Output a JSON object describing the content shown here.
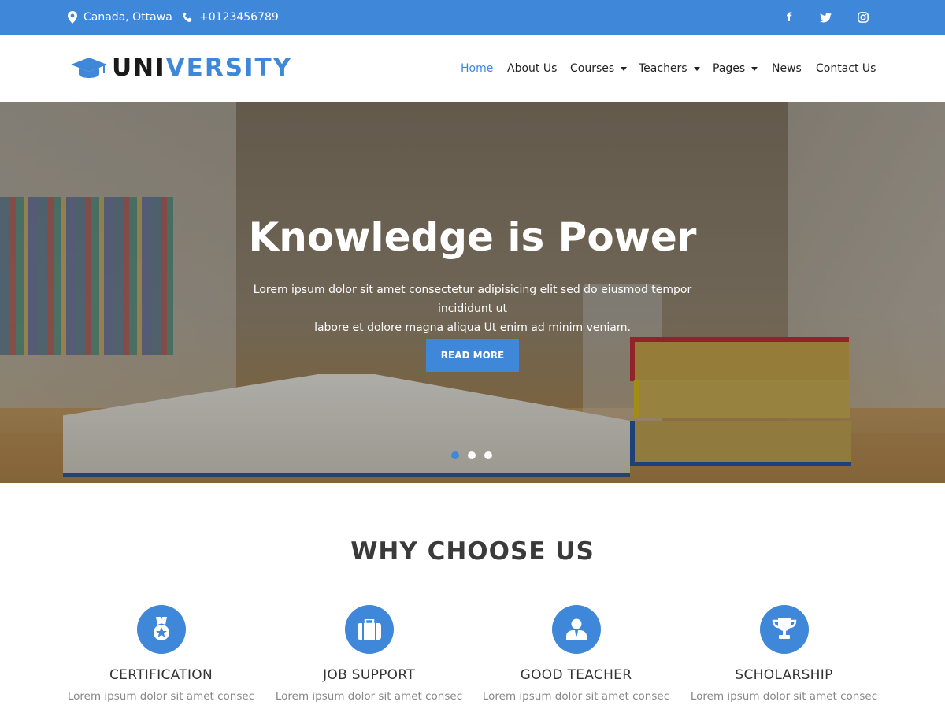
{
  "topbar": {
    "location": "Canada, Ottawa",
    "phone": "+0123456789",
    "social": [
      {
        "icon": "facebook-icon",
        "glyph": "f"
      },
      {
        "icon": "twitter-icon"
      },
      {
        "icon": "instagram-icon"
      }
    ]
  },
  "brand": {
    "part1": "UNI",
    "part2": "VERSITY",
    "accent_color": "#3f87d9"
  },
  "nav": [
    {
      "label": "Home",
      "active": true
    },
    {
      "label": "About Us"
    },
    {
      "label": "Courses",
      "dropdown": true
    },
    {
      "label": "Teachers",
      "dropdown": true
    },
    {
      "label": "Pages",
      "dropdown": true
    },
    {
      "label": "News"
    },
    {
      "label": "Contact Us"
    }
  ],
  "hero": {
    "title": "Knowledge is Power",
    "subtitle_line1": "Lorem ipsum dolor sit amet consectetur adipisicing elit sed do eiusmod tempor incididunt ut",
    "subtitle_line2": "labore et dolore magna aliqua Ut enim ad minim veniam.",
    "button_label": "READ MORE",
    "slides": 3,
    "active_slide": 1
  },
  "why": {
    "title": "WHY CHOOSE US",
    "features": [
      {
        "icon": "medal-icon",
        "title": "CERTIFICATION",
        "desc": "Lorem ipsum dolor sit amet consec"
      },
      {
        "icon": "briefcase-icon",
        "title": "JOB SUPPORT",
        "desc": "Lorem ipsum dolor sit amet consec"
      },
      {
        "icon": "teacher-icon",
        "title": "GOOD TEACHER",
        "desc": "Lorem ipsum dolor sit amet consec"
      },
      {
        "icon": "trophy-icon",
        "title": "SCHOLARSHIP",
        "desc": "Lorem ipsum dolor sit amet consec"
      }
    ]
  }
}
